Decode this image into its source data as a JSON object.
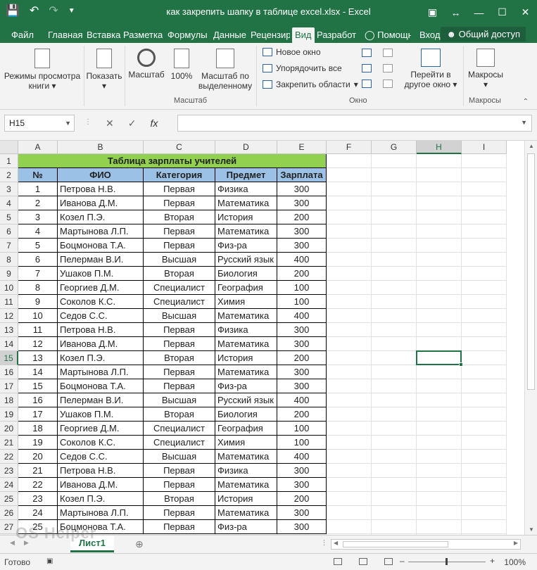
{
  "window": {
    "title": "как закрепить шапку в таблице excel.xlsx - Excel",
    "brand_color": "#217346"
  },
  "tabs": [
    {
      "label": "Файл",
      "active": false
    },
    {
      "label": "Главная",
      "active": false
    },
    {
      "label": "Вставка",
      "active": false
    },
    {
      "label": "Разметка с",
      "active": false
    },
    {
      "label": "Формулы",
      "active": false
    },
    {
      "label": "Данные",
      "active": false
    },
    {
      "label": "Рецензиро",
      "active": false
    },
    {
      "label": "Вид",
      "active": true
    },
    {
      "label": "Разработч",
      "active": false
    },
    {
      "label": "Помощн",
      "active": false
    },
    {
      "label": "Вход",
      "active": false
    }
  ],
  "share_label": "Общий доступ",
  "ribbon": {
    "view_modes_line1": "Режимы просмотра",
    "view_modes_line2": "книги",
    "show": "Показать",
    "zoom": "Масштаб",
    "zoom100": "100%",
    "zoom_sel_line1": "Масштаб по",
    "zoom_sel_line2": "выделенному",
    "group_zoom": "Масштаб",
    "new_window": "Новое окно",
    "arrange_all": "Упорядочить все",
    "freeze_panes": "Закрепить области",
    "group_window": "Окно",
    "switch_line1": "Перейти в",
    "switch_line2": "другое окно",
    "macros": "Макросы",
    "group_macros": "Макросы"
  },
  "formula_bar": {
    "name_box": "H15",
    "fx": "fx",
    "value": ""
  },
  "columns": [
    "A",
    "B",
    "C",
    "D",
    "E",
    "F",
    "G",
    "H",
    "I"
  ],
  "selected_column": "H",
  "selected_row": 15,
  "sheet": {
    "title": "Таблица зарплаты учителей",
    "headers": [
      "№",
      "ФИО",
      "Категория",
      "Предмет",
      "Зарплата"
    ],
    "rows": [
      [
        "1",
        "Петрова Н.В.",
        "Первая",
        "Физика",
        "300"
      ],
      [
        "2",
        "Иванова Д.М.",
        "Первая",
        "Математика",
        "300"
      ],
      [
        "3",
        "Козел П.Э.",
        "Вторая",
        "История",
        "200"
      ],
      [
        "4",
        "Мартынова Л.П.",
        "Первая",
        "Математика",
        "300"
      ],
      [
        "5",
        "Боцмонова Т.А.",
        "Первая",
        "Физ-ра",
        "300"
      ],
      [
        "6",
        "Пелерман В.И.",
        "Высшая",
        "Русский язык",
        "400"
      ],
      [
        "7",
        "Ушаков П.М.",
        "Вторая",
        "Биология",
        "200"
      ],
      [
        "8",
        "Георгиев Д.М.",
        "Специалист",
        "География",
        "100"
      ],
      [
        "9",
        "Соколов К.С.",
        "Специалист",
        "Химия",
        "100"
      ],
      [
        "10",
        "Седов С.С.",
        "Высшая",
        "Математика",
        "400"
      ],
      [
        "11",
        "Петрова Н.В.",
        "Первая",
        "Физика",
        "300"
      ],
      [
        "12",
        "Иванова Д.М.",
        "Первая",
        "Математика",
        "300"
      ],
      [
        "13",
        "Козел П.Э.",
        "Вторая",
        "История",
        "200"
      ],
      [
        "14",
        "Мартынова Л.П.",
        "Первая",
        "Математика",
        "300"
      ],
      [
        "15",
        "Боцмонова Т.А.",
        "Первая",
        "Физ-ра",
        "300"
      ],
      [
        "16",
        "Пелерман В.И.",
        "Высшая",
        "Русский язык",
        "400"
      ],
      [
        "17",
        "Ушаков П.М.",
        "Вторая",
        "Биология",
        "200"
      ],
      [
        "18",
        "Георгиев Д.М.",
        "Специалист",
        "География",
        "100"
      ],
      [
        "19",
        "Соколов К.С.",
        "Специалист",
        "Химия",
        "100"
      ],
      [
        "20",
        "Седов С.С.",
        "Высшая",
        "Математика",
        "400"
      ],
      [
        "21",
        "Петрова Н.В.",
        "Первая",
        "Физика",
        "300"
      ],
      [
        "22",
        "Иванова Д.М.",
        "Первая",
        "Математика",
        "300"
      ],
      [
        "23",
        "Козел П.Э.",
        "Вторая",
        "История",
        "200"
      ],
      [
        "24",
        "Мартынова Л.П.",
        "Первая",
        "Математика",
        "300"
      ],
      [
        "25",
        "Боцмонова Т.А.",
        "Первая",
        "Физ-ра",
        "300"
      ]
    ]
  },
  "sheet_tab": "Лист1",
  "status": {
    "ready": "Готово",
    "zoom": "100%"
  },
  "watermark": "OS Helper"
}
